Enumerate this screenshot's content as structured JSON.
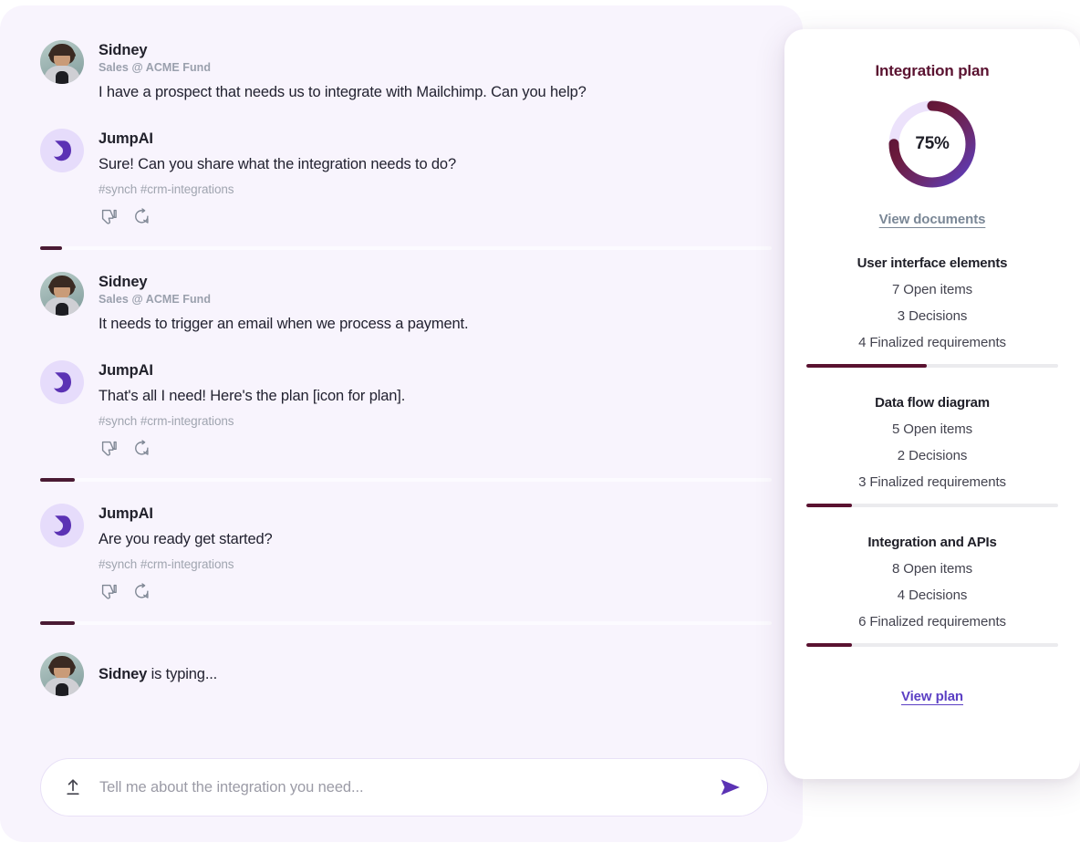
{
  "chat": {
    "messages": [
      {
        "sender": "Sidney",
        "role": "Sales @ ACME Fund",
        "text": "I have a prospect that needs us to integrate with Mailchimp. Can you help?",
        "tags": "",
        "type": "user"
      },
      {
        "sender": "JumpAI",
        "role": "",
        "text": "Sure! Can you share what the integration needs to do?",
        "tags": "#synch #crm-integrations",
        "type": "bot"
      },
      {
        "sender": "Sidney",
        "role": "Sales @ ACME Fund",
        "text": "It needs to trigger an email when we process a payment.",
        "tags": "",
        "type": "user"
      },
      {
        "sender": "JumpAI",
        "role": "",
        "text": "That's all I need! Here's the plan [icon for plan].",
        "tags": "#synch #crm-integrations",
        "type": "bot"
      },
      {
        "sender": "JumpAI",
        "role": "",
        "text": "Are you ready get started?",
        "tags": "#synch #crm-integrations",
        "type": "bot"
      }
    ],
    "typing": {
      "name": "Sidney",
      "suffix": " is typing..."
    },
    "actions": {
      "thumbs_down": "thumbs-down-icon",
      "regenerate": "regenerate-icon"
    }
  },
  "composer": {
    "placeholder": "Tell me about the integration you need...",
    "value": "",
    "upload_icon": "upload-icon",
    "send_icon": "send-icon"
  },
  "plan": {
    "title": "Integration plan",
    "progress_label": "75%",
    "progress_value": 75,
    "view_documents_label": "View documents",
    "view_plan_label": "View plan",
    "sections": [
      {
        "title": "User interface elements",
        "open_items": "7 Open items",
        "decisions": "3 Decisions",
        "finalized": "4 Finalized requirements",
        "bar_percent": 48
      },
      {
        "title": "Data flow diagram",
        "open_items": "5 Open items",
        "decisions": "2 Decisions",
        "finalized": "3 Finalized requirements",
        "bar_percent": 18
      },
      {
        "title": "Integration and APIs",
        "open_items": "8 Open items",
        "decisions": "4 Decisions",
        "finalized": "6 Finalized requirements",
        "bar_percent": 18
      }
    ]
  },
  "colors": {
    "accent_maroon": "#5a1230",
    "accent_purple": "#5b3fc4",
    "chat_bg": "#f8f4fd",
    "panel_bg": "#ffffff",
    "bot_avatar_bg": "#e6dcfb",
    "muted_text": "#a0a5b0"
  }
}
